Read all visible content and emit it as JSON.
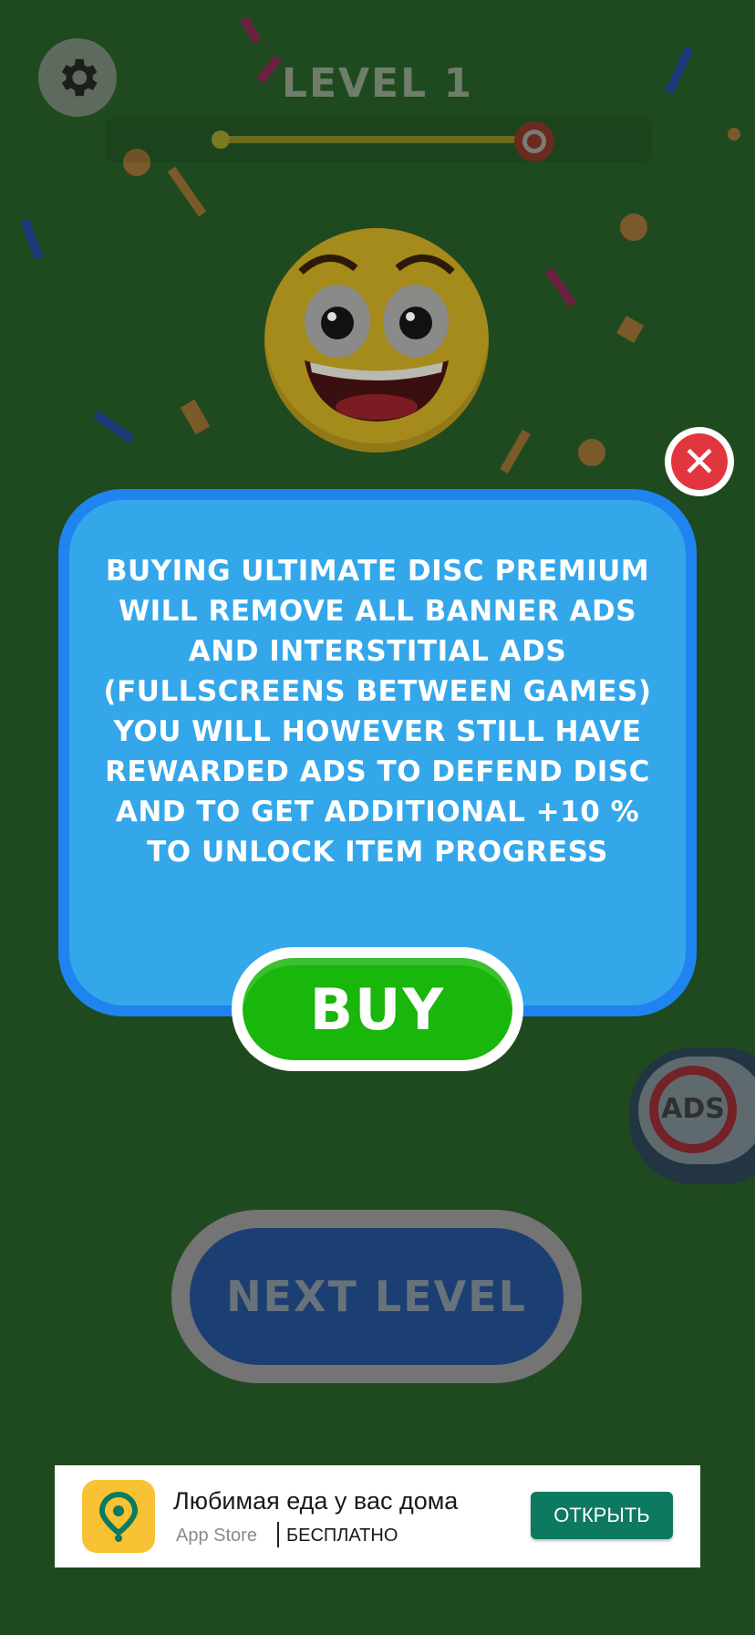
{
  "hud": {
    "level_title": "LEVEL 1",
    "settings_icon": "gear-icon",
    "level_progress": 1.0
  },
  "popup": {
    "message": "BUYING ULTIMATE DISC PREMIUM WILL REMOVE ALL BANNER ADS AND INTERSTITIAL ADS (FULLSCREENS BETWEEN GAMES) YOU WILL HOWEVER STILL HAVE REWARDED ADS TO DEFEND DISC AND TO GET ADDITIONAL +10 % TO UNLOCK ITEM PROGRESS",
    "buy_label": "BUY",
    "close_icon": "close-icon"
  },
  "background": {
    "next_level_label": "NEXT LEVEL",
    "no_ads_label": "ADS"
  },
  "ad": {
    "title": "Любимая еда у вас дома",
    "store": "App Store",
    "price": "БЕСПЛАТНО",
    "cta": "ОТКРЫТЬ",
    "icon": "location-pin-icon"
  },
  "colors": {
    "background": "#1f4a1f",
    "popup_border": "#1f84f0",
    "popup_fill": "#33a7ea",
    "buy_green": "#19b60c",
    "close_red": "#e2363f",
    "ad_cta": "#0d7a5f"
  }
}
